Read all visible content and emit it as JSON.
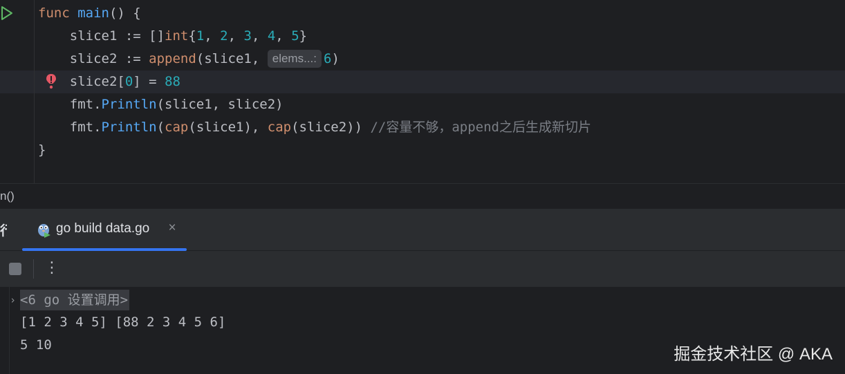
{
  "editor": {
    "lines": [
      {
        "tokens": [
          {
            "t": "func",
            "c": "kw"
          },
          {
            "t": " "
          },
          {
            "t": "main",
            "c": "fn"
          },
          {
            "t": "() {"
          }
        ]
      },
      {
        "tokens": [
          {
            "t": "    slice1 := []"
          },
          {
            "t": "int",
            "c": "kw"
          },
          {
            "t": "{"
          },
          {
            "t": "1",
            "c": "num"
          },
          {
            "t": ", "
          },
          {
            "t": "2",
            "c": "num"
          },
          {
            "t": ", "
          },
          {
            "t": "3",
            "c": "num"
          },
          {
            "t": ", "
          },
          {
            "t": "4",
            "c": "num"
          },
          {
            "t": ", "
          },
          {
            "t": "5",
            "c": "num"
          },
          {
            "t": "}"
          }
        ]
      },
      {
        "tokens": [
          {
            "t": "    slice2 := "
          },
          {
            "t": "append",
            "c": "bi"
          },
          {
            "t": "(slice1, "
          },
          {
            "t": "elems...:",
            "c": "hint"
          },
          {
            "t": "6",
            "c": "num"
          },
          {
            "t": ")"
          }
        ]
      },
      {
        "tokens": [
          {
            "t": "    slice2["
          },
          {
            "t": "0",
            "c": "num"
          },
          {
            "t": "] = "
          },
          {
            "t": "88",
            "c": "num"
          }
        ]
      },
      {
        "tokens": [
          {
            "t": "    fmt.",
            "c": ""
          },
          {
            "t": "Println",
            "c": "fn"
          },
          {
            "t": "(slice1, slice2)"
          }
        ]
      },
      {
        "tokens": [
          {
            "t": "    fmt.",
            "c": ""
          },
          {
            "t": "Println",
            "c": "fn"
          },
          {
            "t": "("
          },
          {
            "t": "cap",
            "c": "bi"
          },
          {
            "t": "(slice1), "
          },
          {
            "t": "cap",
            "c": "bi"
          },
          {
            "t": "(slice2)) "
          },
          {
            "t": "//容量不够，append之后生成新切片",
            "c": "cm"
          }
        ]
      },
      {
        "tokens": [
          {
            "t": "}"
          }
        ]
      }
    ]
  },
  "breadcrumb": "n()",
  "run_panel": {
    "title": "行",
    "tab_label": "go build data.go",
    "tab_close": "×",
    "more_glyph": "⋮",
    "console": {
      "header": "<6 go 设置调用>",
      "lines": [
        "[1 2 3 4 5] [88 2 3 4 5 6]",
        "5 10"
      ]
    }
  },
  "watermark": "掘金技术社区 @ AKA",
  "colors": {
    "background": "#1e1f22",
    "panel": "#2b2d30",
    "keyword": "#cf8e6d",
    "function": "#56a8f5",
    "number": "#2aacb8",
    "comment": "#7a7e85",
    "tab_underline": "#3574f0",
    "run_icon": "#5fb865",
    "breakpoint": "#e55765"
  },
  "icons": {
    "run_gutter": "run-triangle-icon",
    "breakpoint": "error-exclamation-icon",
    "tab": "gopher-run-icon",
    "stop": "stop-icon",
    "more": "more-vertical-icon",
    "fold": "chevron-right-icon"
  }
}
